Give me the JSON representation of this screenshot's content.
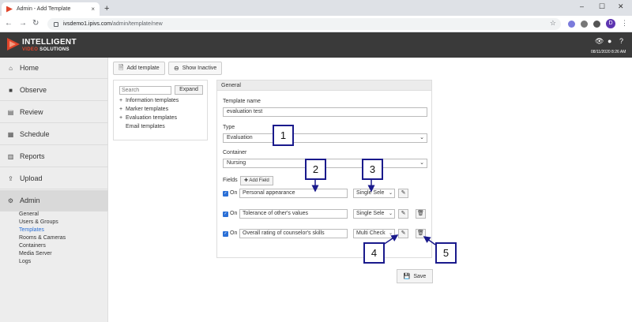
{
  "browser": {
    "tab_title": "Admin - Add Template",
    "tab_close": "×",
    "new_tab": "+",
    "url_host": "ivsdemo1.ipivs.com",
    "url_path": "/admin/template/new",
    "profile_initial": "D",
    "window_controls": [
      "–",
      "☐",
      "✕"
    ]
  },
  "header": {
    "logo_line1": "INTELLIGENT",
    "logo_line2_a": "VIDEO",
    "logo_line2_b": " SOLUTIONS",
    "timestamp": "08/11/2020 8:26 AM",
    "brand_color": "#e0452b"
  },
  "sidebar": {
    "items": [
      {
        "label": "Home",
        "icon": "home-icon"
      },
      {
        "label": "Observe",
        "icon": "video-camera-icon"
      },
      {
        "label": "Review",
        "icon": "film-icon"
      },
      {
        "label": "Schedule",
        "icon": "calendar-icon"
      },
      {
        "label": "Reports",
        "icon": "bar-chart-icon"
      },
      {
        "label": "Upload",
        "icon": "upload-icon"
      },
      {
        "label": "Admin",
        "icon": "gear-icon"
      }
    ],
    "admin_sub": [
      "General",
      "Users & Groups",
      "Templates",
      "Rooms & Cameras",
      "Containers",
      "Media Server",
      "Logs"
    ]
  },
  "toolbar": {
    "add_template": "Add template",
    "show_inactive": "Show Inactive"
  },
  "tree": {
    "search_placeholder": "Search",
    "expand": "Expand",
    "items": [
      "Information templates",
      "Marker templates",
      "Evaluation templates",
      "Email templates"
    ]
  },
  "form": {
    "panel_title": "General",
    "template_name_label": "Template name",
    "template_name_value": "evaluation test",
    "type_label": "Type",
    "type_value": "Evaluation",
    "container_label": "Container",
    "container_value": "Nursing",
    "fields_label": "Fields",
    "add_field": "Add Field",
    "on_label": "On",
    "fields": [
      {
        "name": "Personal appearance",
        "type": "Single Sele"
      },
      {
        "name": "Tolerance of other's values",
        "type": "Single Sele"
      },
      {
        "name": "Overall rating of counselor's skills",
        "type": "Multi Check"
      }
    ],
    "save": "Save"
  },
  "callouts": [
    "1",
    "2",
    "3",
    "4",
    "5"
  ],
  "accent_color": "#2a6fd6",
  "callout_color": "#1a1a8c"
}
